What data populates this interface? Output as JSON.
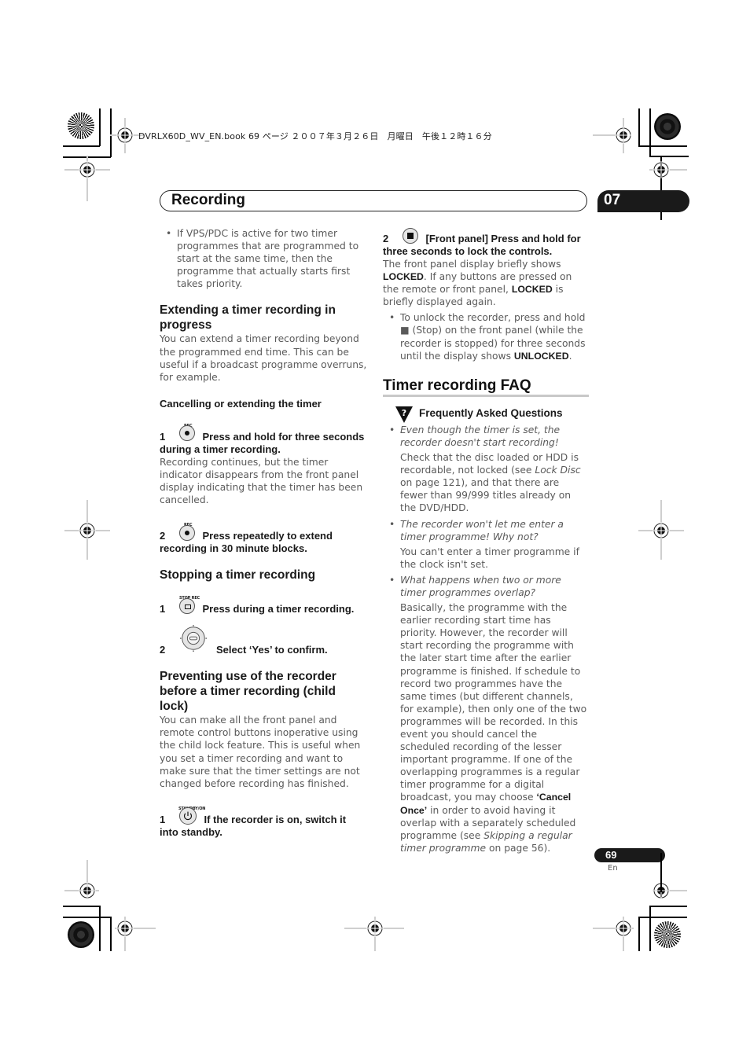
{
  "print_header": {
    "file_info": "DVRLX60D_WV_EN.book  69 ページ  ２００７年３月２６日　月曜日　午後１２時１６分"
  },
  "chapter": {
    "title": "Recording",
    "number": "07"
  },
  "left_column": {
    "intro_bullet": "If VPS/PDC is active for two timer programmes that are programmed to start at the same time, then the programme that actually starts first takes priority.",
    "extending": {
      "heading": "Extending a timer recording in progress",
      "body": "You can extend a timer recording beyond the programmed end time. This can be useful if a broadcast programme overruns, for example.",
      "subheading": "Cancelling or extending the timer",
      "steps": [
        {
          "num": "1",
          "button_label": "REC",
          "icon": "rec-button-icon",
          "text": "Press and hold for three seconds during a timer recording.",
          "note": "Recording continues, but the timer indicator disappears from the front panel display indicating that the timer has been cancelled."
        },
        {
          "num": "2",
          "button_label": "REC",
          "icon": "rec-button-icon",
          "text": "Press repeatedly to extend recording in 30 minute blocks."
        }
      ]
    },
    "stopping": {
      "heading": "Stopping a timer recording",
      "steps": [
        {
          "num": "1",
          "button_label": "STOP REC",
          "icon": "stop-rec-button-icon",
          "text": "Press during a timer recording."
        },
        {
          "num": "2",
          "icon": "direction-pad-icon",
          "text": "Select ‘Yes’ to confirm."
        }
      ]
    },
    "child_lock": {
      "heading": "Preventing use of the recorder before a timer recording (child lock)",
      "body": "You can make all the front panel and remote control buttons inoperative using the child lock feature. This is useful when you set a timer recording and want to make sure that the timer settings are not changed before recording has finished.",
      "steps": [
        {
          "num": "1",
          "button_label": "STANDBY/ON",
          "icon": "standby-button-icon",
          "text": "If the recorder is on, switch it into standby."
        }
      ]
    }
  },
  "right_column": {
    "lock_step": {
      "num": "2",
      "icon": "stop-button-icon",
      "text": "[Front panel] Press and hold for three seconds to lock the controls.",
      "body_parts": [
        "The front panel display briefly shows ",
        "LOCKED",
        ". If any buttons are pressed on the remote or front panel, ",
        "LOCKED",
        " is briefly displayed again."
      ],
      "bullet_parts": [
        "To unlock the recorder, press and hold ",
        "■ (Stop) on the front panel (while the recorder is stopped) for three seconds until the display shows ",
        "UNLOCKED",
        "."
      ]
    },
    "faq": {
      "heading": "Timer recording FAQ",
      "badge_label": "Frequently Asked Questions",
      "items": [
        {
          "question": "Even though the timer is set, the recorder doesn't start recording!",
          "answer_parts": [
            "Check that the disc loaded or HDD is recordable, not locked (see ",
            "Lock Disc",
            " on page 121), and that there are fewer than 99/999 titles already on the DVD/HDD."
          ]
        },
        {
          "question": "The recorder won't let me enter a timer programme! Why not?",
          "answer_parts": [
            "You can't enter a timer programme if the clock isn't set."
          ]
        },
        {
          "question": "What happens when two or more timer programmes overlap?",
          "answer_parts": [
            "Basically, the programme with the earlier recording start time has priority. However, the recorder will start recording the programme with the later start time after the earlier programme is finished. If schedule to record two programmes have the same times (but different channels, for example), then only one of the two programmes will be recorded. In this event you should cancel the scheduled recording of the lesser important programme. If one of the overlapping programmes is a regular timer programme for a digital broadcast, you may choose ",
            "‘Cancel Once’",
            " in order to avoid having it overlap with a separately scheduled programme (see ",
            "Skipping a regular timer programme",
            " on page 56)."
          ]
        }
      ]
    }
  },
  "footer": {
    "page_number": "69",
    "language": "En"
  }
}
